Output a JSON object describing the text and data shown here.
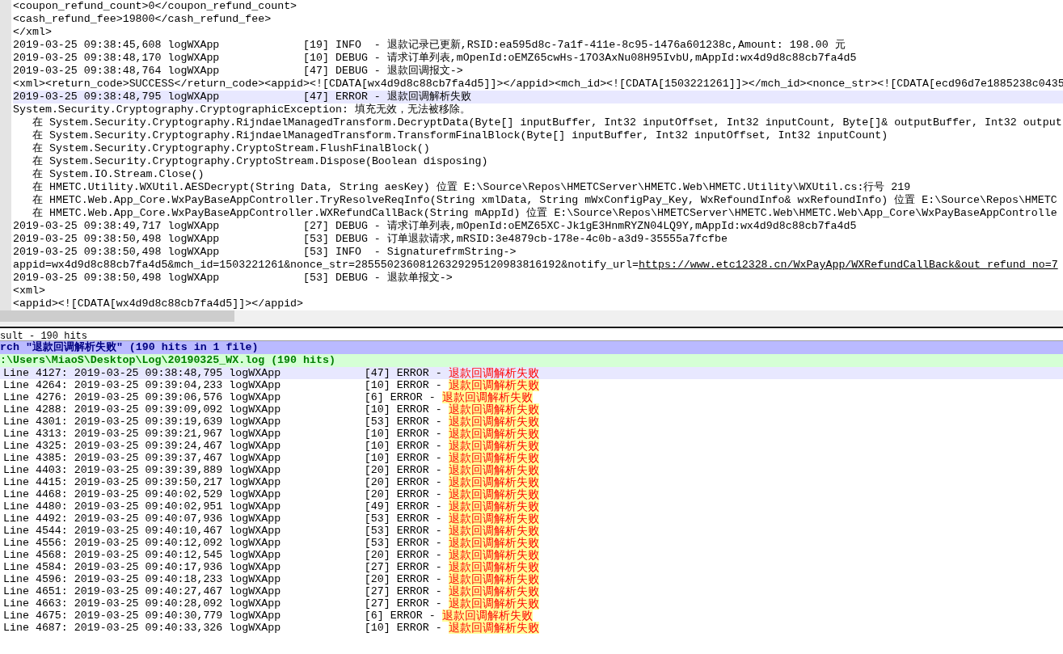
{
  "editor": {
    "lines": [
      {
        "text": "<coupon_refund_count>0</coupon_refund_count>",
        "current": false
      },
      {
        "text": "<cash_refund_fee>19800</cash_refund_fee>",
        "current": false
      },
      {
        "text": "</xml>",
        "current": false
      },
      {
        "text": "2019-03-25 09:38:45,608 logWXApp             [19] INFO  - 退款记录已更新,RSID:ea595d8c-7a1f-411e-8c95-1476a601238c,Amount: 198.00 元",
        "current": false
      },
      {
        "text": "2019-03-25 09:38:48,170 logWXApp             [10] DEBUG - 请求订单列表,mOpenId:oEMZ65cwHs-17O3AxNu08H95IvbU,mAppId:wx4d9d8c88cb7fa4d5",
        "current": false
      },
      {
        "text": "2019-03-25 09:38:48,764 logWXApp             [47] DEBUG - 退款回调报文->",
        "current": false
      },
      {
        "text": "<xml><return_code>SUCCESS</return_code><appid><![CDATA[wx4d9d8c88cb7fa4d5]]></appid><mch_id><![CDATA[1503221261]]></mch_id><nonce_str><![CDATA[ecd96d7e1885238c0435",
        "current": false
      },
      {
        "text": "2019-03-25 09:38:48,795 logWXApp             [47] ERROR - 退款回调解析失败",
        "current": true
      },
      {
        "text": "System.Security.Cryptography.CryptographicException: 填充无效，无法被移除。",
        "current": false
      },
      {
        "text": "   在 System.Security.Cryptography.RijndaelManagedTransform.DecryptData(Byte[] inputBuffer, Int32 inputOffset, Int32 inputCount, Byte[]& outputBuffer, Int32 output",
        "current": false
      },
      {
        "text": "   在 System.Security.Cryptography.RijndaelManagedTransform.TransformFinalBlock(Byte[] inputBuffer, Int32 inputOffset, Int32 inputCount)",
        "current": false
      },
      {
        "text": "   在 System.Security.Cryptography.CryptoStream.FlushFinalBlock()",
        "current": false
      },
      {
        "text": "   在 System.Security.Cryptography.CryptoStream.Dispose(Boolean disposing)",
        "current": false
      },
      {
        "text": "   在 System.IO.Stream.Close()",
        "current": false
      },
      {
        "text": "   在 HMETC.Utility.WXUtil.AESDecrypt(String Data, String aesKey) 位置 E:\\Source\\Repos\\HMETCServer\\HMETC.Web\\HMETC.Utility\\WXUtil.cs:行号 219",
        "current": false
      },
      {
        "text": "   在 HMETC.Web.App_Core.WxPayBaseAppController.TryResolveReqInfo(String xmlData, String mWxConfigPay_Key, WxRefoundInfo& wxRefoundInfo) 位置 E:\\Source\\Repos\\HMETC",
        "current": false
      },
      {
        "text": "   在 HMETC.Web.App_Core.WxPayBaseAppController.WXRefundCallBack(String mAppId) 位置 E:\\Source\\Repos\\HMETCServer\\HMETC.Web\\HMETC.Web\\App_Core\\WxPayBaseAppControlle",
        "current": false
      },
      {
        "text": "2019-03-25 09:38:49,717 logWXApp             [27] DEBUG - 请求订单列表,mOpenId:oEMZ65XC-Jk1gE3HnmRYZN04LQ9Y,mAppId:wx4d9d8c88cb7fa4d5",
        "current": false
      },
      {
        "text": "2019-03-25 09:38:50,498 logWXApp             [53] DEBUG - 订单退款请求,mRSID:3e4879cb-178e-4c0b-a3d9-35555a7fcfbe",
        "current": false
      },
      {
        "text": "2019-03-25 09:38:50,498 logWXApp             [53] INFO  - SignaturefrmString->",
        "current": false
      },
      {
        "text": "appid=wx4d9d8c88cb7fa4d5&mch_id=1503221261&nonce_str=28555023608126329295120983816192&notify_url=",
        "link": "https://www.etc12328.cn/WxPayApp/WXRefundCallBack&out_refund_no=7",
        "current": false
      },
      {
        "text": "2019-03-25 09:38:50,498 logWXApp             [53] DEBUG - 退款单报文->",
        "current": false
      },
      {
        "text": "<xml>",
        "current": false
      },
      {
        "text": "<appid><![CDATA[wx4d9d8c88cb7fa4d5]]></appid>",
        "current": false
      }
    ]
  },
  "results": {
    "title": "sult - 190 hits",
    "search": "rch \"退款回调解析失败\" (190 hits in 1 file)",
    "file": ":\\Users\\MiaoS\\Desktop\\Log\\20190325_WX.log (190 hits)",
    "rows": [
      {
        "line": "Line 4127:",
        "text": "2019-03-25 09:38:48,795 logWXApp             [47] ERROR - ",
        "match": "退款回调解析失败",
        "selected": true
      },
      {
        "line": "Line 4264:",
        "text": "2019-03-25 09:39:04,233 logWXApp             [10] ERROR - ",
        "match": "退款回调解析失败",
        "selected": false
      },
      {
        "line": "Line 4276:",
        "text": "2019-03-25 09:39:06,576 logWXApp             [6] ERROR - ",
        "match": "退款回调解析失败",
        "selected": false
      },
      {
        "line": "Line 4288:",
        "text": "2019-03-25 09:39:09,092 logWXApp             [10] ERROR - ",
        "match": "退款回调解析失败",
        "selected": false
      },
      {
        "line": "Line 4301:",
        "text": "2019-03-25 09:39:19,639 logWXApp             [53] ERROR - ",
        "match": "退款回调解析失败",
        "selected": false
      },
      {
        "line": "Line 4313:",
        "text": "2019-03-25 09:39:21,967 logWXApp             [10] ERROR - ",
        "match": "退款回调解析失败",
        "selected": false
      },
      {
        "line": "Line 4325:",
        "text": "2019-03-25 09:39:24,467 logWXApp             [10] ERROR - ",
        "match": "退款回调解析失败",
        "selected": false
      },
      {
        "line": "Line 4385:",
        "text": "2019-03-25 09:39:37,467 logWXApp             [10] ERROR - ",
        "match": "退款回调解析失败",
        "selected": false
      },
      {
        "line": "Line 4403:",
        "text": "2019-03-25 09:39:39,889 logWXApp             [20] ERROR - ",
        "match": "退款回调解析失败",
        "selected": false
      },
      {
        "line": "Line 4415:",
        "text": "2019-03-25 09:39:50,217 logWXApp             [20] ERROR - ",
        "match": "退款回调解析失败",
        "selected": false
      },
      {
        "line": "Line 4468:",
        "text": "2019-03-25 09:40:02,529 logWXApp             [20] ERROR - ",
        "match": "退款回调解析失败",
        "selected": false
      },
      {
        "line": "Line 4480:",
        "text": "2019-03-25 09:40:02,951 logWXApp             [49] ERROR - ",
        "match": "退款回调解析失败",
        "selected": false
      },
      {
        "line": "Line 4492:",
        "text": "2019-03-25 09:40:07,936 logWXApp             [53] ERROR - ",
        "match": "退款回调解析失败",
        "selected": false
      },
      {
        "line": "Line 4544:",
        "text": "2019-03-25 09:40:10,467 logWXApp             [53] ERROR - ",
        "match": "退款回调解析失败",
        "selected": false
      },
      {
        "line": "Line 4556:",
        "text": "2019-03-25 09:40:12,092 logWXApp             [53] ERROR - ",
        "match": "退款回调解析失败",
        "selected": false
      },
      {
        "line": "Line 4568:",
        "text": "2019-03-25 09:40:12,545 logWXApp             [20] ERROR - ",
        "match": "退款回调解析失败",
        "selected": false
      },
      {
        "line": "Line 4584:",
        "text": "2019-03-25 09:40:17,936 logWXApp             [27] ERROR - ",
        "match": "退款回调解析失败",
        "selected": false
      },
      {
        "line": "Line 4596:",
        "text": "2019-03-25 09:40:18,233 logWXApp             [20] ERROR - ",
        "match": "退款回调解析失败",
        "selected": false
      },
      {
        "line": "Line 4651:",
        "text": "2019-03-25 09:40:27,467 logWXApp             [27] ERROR - ",
        "match": "退款回调解析失败",
        "selected": false
      },
      {
        "line": "Line 4663:",
        "text": "2019-03-25 09:40:28,092 logWXApp             [27] ERROR - ",
        "match": "退款回调解析失败",
        "selected": false
      },
      {
        "line": "Line 4675:",
        "text": "2019-03-25 09:40:30,779 logWXApp             [6] ERROR - ",
        "match": "退款回调解析失败",
        "selected": false
      },
      {
        "line": "Line 4687:",
        "text": "2019-03-25 09:40:33,326 logWXApp             [10] ERROR - ",
        "match": "退款回调解析失败",
        "selected": false
      }
    ]
  }
}
